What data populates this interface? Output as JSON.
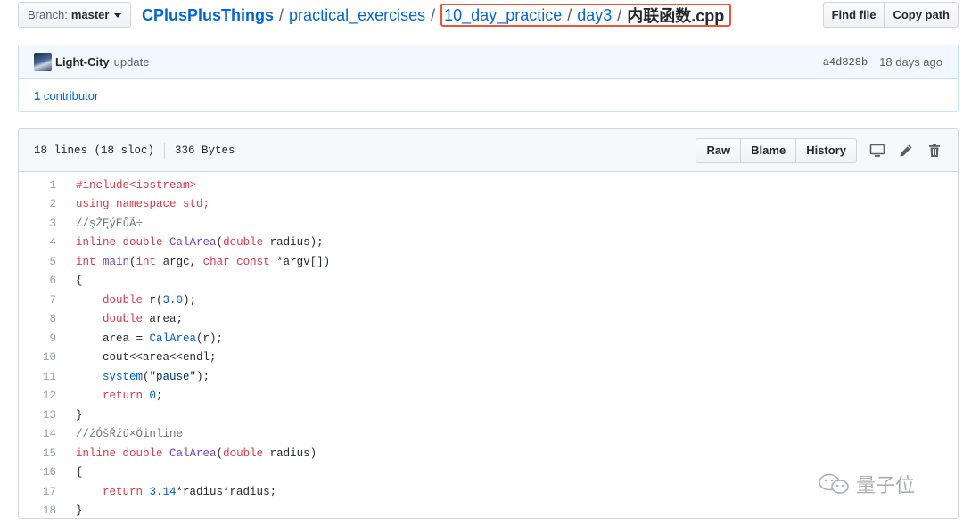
{
  "branch": {
    "label": "Branch:",
    "value": "master"
  },
  "breadcrumb": {
    "repo": "CPlusPlusThings",
    "sep1": "/",
    "dir1": "practical_exercises",
    "sep2": "/",
    "dir2": "10_day_practice",
    "sep3": "/",
    "dir3": "day3",
    "sep4": "/",
    "file": "内联函数.cpp"
  },
  "toolbar": {
    "find_file": "Find file",
    "copy_path": "Copy path"
  },
  "commit": {
    "author": "Light-City",
    "message": "update",
    "sha": "a4d828b",
    "date": "18 days ago"
  },
  "contributors": {
    "count": "1",
    "label": "contributor"
  },
  "file_info": {
    "lines": "18 lines (18 sloc)",
    "size": "336 Bytes"
  },
  "file_actions": {
    "raw": "Raw",
    "blame": "Blame",
    "history": "History"
  },
  "icons": {
    "desktop": "desktop-icon",
    "edit": "pencil-icon",
    "delete": "trash-icon"
  },
  "code_lines": [
    "1",
    "2",
    "3",
    "4",
    "5",
    "6",
    "7",
    "8",
    "9",
    "10",
    "11",
    "12",
    "13",
    "14",
    "15",
    "16",
    "17",
    "18"
  ],
  "code": {
    "l1": {
      "a": "#include<iostream>"
    },
    "l2": {
      "a": "using namespace std;"
    },
    "l3": {
      "a": "//şŽĘýÉůÃ÷"
    },
    "l4": {
      "k1": "inline double ",
      "f1": "CalArea",
      "p1": "(",
      "k2": "double",
      "r": " radius);"
    },
    "l5": {
      "k1": "int ",
      "f1": "main",
      "p1": "(",
      "k2": "int",
      "t1": " argc, ",
      "k3": "char const",
      "t2": " *argv[])"
    },
    "l6": {
      "a": "{"
    },
    "l7": {
      "k1": "double",
      "t1": " r(",
      "n1": "3.0",
      "t2": ");"
    },
    "l8": {
      "k1": "double",
      "t1": " area;"
    },
    "l9": {
      "t1": "area = ",
      "f1": "CalArea",
      "t2": "(r);"
    },
    "l10": {
      "t1": "cout<<area<<endl;"
    },
    "l11": {
      "f1": "system",
      "t1": "(",
      "s1": "\"pause\"",
      "t2": ");"
    },
    "l12": {
      "k1": "return ",
      "n1": "0",
      "t1": ";"
    },
    "l13": {
      "a": "}"
    },
    "l14": {
      "a": "//źÓšŘźü×Öinline"
    },
    "l15": {
      "k1": "inline double ",
      "f1": "CalArea",
      "p1": "(",
      "k2": "double",
      "r": " radius)"
    },
    "l16": {
      "a": "{"
    },
    "l17": {
      "k1": "return ",
      "n1": "3.14",
      "t1": "*radius*radius;"
    },
    "l18": {
      "a": "}"
    }
  },
  "watermark": {
    "text": "量子位"
  },
  "colors": {
    "link": "#0366d6",
    "keyword": "#d73a49",
    "highlight_border": "#e8553a",
    "commit_bg": "#f1f8ff"
  }
}
